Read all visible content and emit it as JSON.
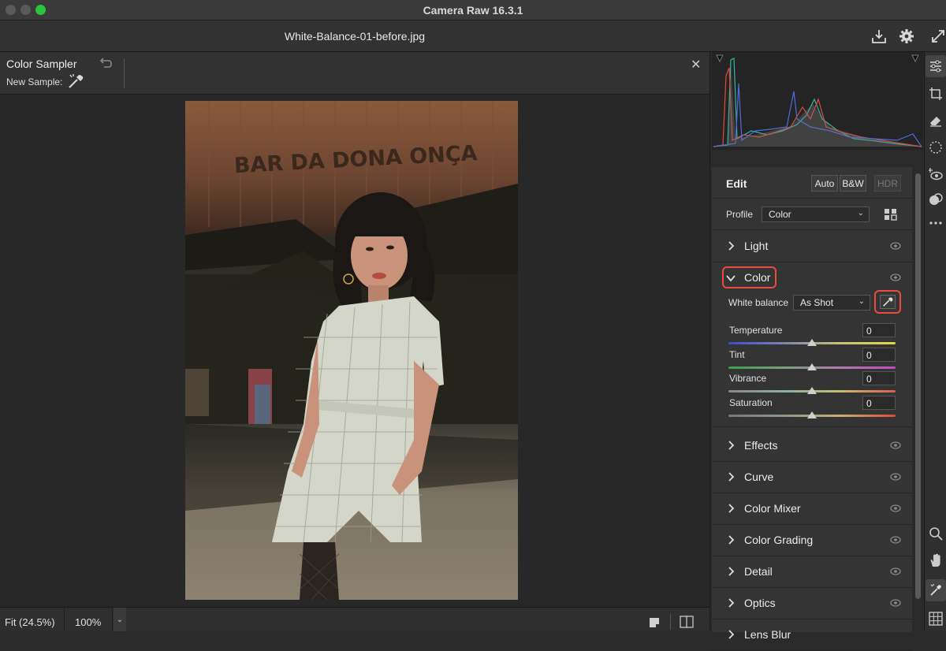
{
  "window": {
    "title": "Camera Raw 16.3.1"
  },
  "file": {
    "name": "White-Balance-01-before.jpg"
  },
  "tool": {
    "title": "Color Sampler",
    "new_sample_label": "New Sample:"
  },
  "status": {
    "zoom_fit": "Fit (24.5%)",
    "zoom_100": "100%"
  },
  "edit": {
    "title": "Edit",
    "auto_label": "Auto",
    "bw_label": "B&W",
    "hdr_label": "HDR",
    "profile_label": "Profile",
    "profile_value": "Color"
  },
  "sections": {
    "light": "Light",
    "color": "Color",
    "effects": "Effects",
    "curve": "Curve",
    "color_mixer": "Color Mixer",
    "color_grading": "Color Grading",
    "detail": "Detail",
    "optics": "Optics",
    "lens_blur": "Lens Blur"
  },
  "color_panel": {
    "white_balance_label": "White balance",
    "white_balance_value": "As Shot",
    "sliders": [
      {
        "label": "Temperature",
        "value": "0"
      },
      {
        "label": "Tint",
        "value": "0"
      },
      {
        "label": "Vibrance",
        "value": "0"
      },
      {
        "label": "Saturation",
        "value": "0"
      }
    ]
  },
  "photo": {
    "sign_text": "BAR DA DONA ONÇA"
  },
  "colors": {
    "highlight": "#e94b3c",
    "traffic_green": "#2ac33f"
  },
  "icons": [
    "save-icon",
    "gear-icon",
    "expand-icon",
    "undo-icon",
    "color-sampler-icon",
    "close-icon",
    "edit-tool-icon",
    "crop-icon",
    "eraser-icon",
    "masking-icon",
    "red-eye-icon",
    "presets-icon",
    "more-icon",
    "zoom-icon",
    "hand-icon",
    "sampler-tool-icon",
    "grid-icon",
    "eye-icon"
  ]
}
